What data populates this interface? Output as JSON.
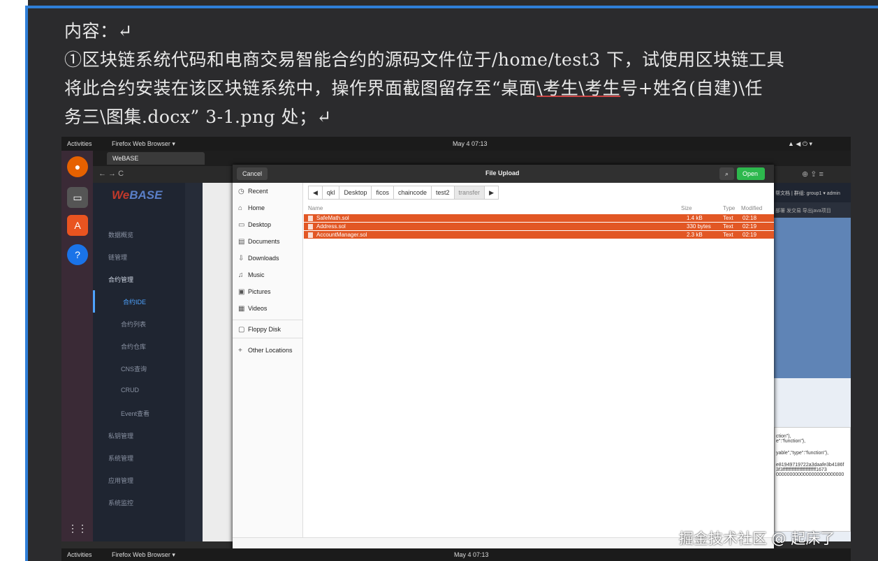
{
  "document": {
    "line1": "内容：↵",
    "line2": "①区块链系统代码和电商交易智能合约的源码文件位于/home/test3 下，试使用区块链工具",
    "line3a": "将此合约安装在该区块链系统中，操作界面截图留存至“桌面",
    "line3b": "\\考生\\考生",
    "line3c": "号+姓名(自建)\\任",
    "line4": "务三\\图集.docx” 3-1.png 处；↵"
  },
  "topbar": {
    "activities": "Activities",
    "app": "Firefox Web Browser ▾",
    "clock": "May 4  07:13",
    "tray": "▲ ◀ ⏻ ▾"
  },
  "browser": {
    "tab_label": "WeBASE",
    "url_nav": "← → C",
    "right_icons": "⊕ ⇪ ≡"
  },
  "webase": {
    "logo_a": "We",
    "logo_b": "BASE",
    "nav": [
      {
        "label": "数据概览"
      },
      {
        "label": "链管理"
      },
      {
        "label": "合约管理"
      },
      {
        "label": "合约IDE"
      },
      {
        "label": "合约列表"
      },
      {
        "label": "合约仓库"
      },
      {
        "label": "CNS查询"
      },
      {
        "label": "CRUD"
      },
      {
        "label": "Event查看"
      },
      {
        "label": "私钥管理"
      },
      {
        "label": "系统管理"
      },
      {
        "label": "应用管理"
      },
      {
        "label": "系统监控"
      }
    ],
    "header_right": "帮文档 | 群组: group1 ▾  admin",
    "toolbar_right": "部署  发交易  导出java项目",
    "code_lines": [
      "ction\"),",
      "e\":\"function\"),",
      "yable\",\"type\":\"function\"),",
      "e81949719722a3daafe3b4186f",
      "3f3ffffffffffffffffffffffffff1673",
      "0000000000000000000000000"
    ]
  },
  "dialog": {
    "title": "File Upload",
    "cancel": "Cancel",
    "open": "Open",
    "sidebar": [
      {
        "icon": "◷",
        "label": "Recent"
      },
      {
        "icon": "⌂",
        "label": "Home"
      },
      {
        "icon": "▭",
        "label": "Desktop"
      },
      {
        "icon": "▤",
        "label": "Documents"
      },
      {
        "icon": "⇩",
        "label": "Downloads"
      },
      {
        "icon": "♫",
        "label": "Music"
      },
      {
        "icon": "▣",
        "label": "Pictures"
      },
      {
        "icon": "▦",
        "label": "Videos"
      },
      {
        "icon": "▢",
        "label": "Floppy Disk"
      },
      {
        "icon": "+",
        "label": "Other Locations"
      }
    ],
    "breadcrumbs": [
      "◀",
      "qkl",
      "Desktop",
      "ficos",
      "chaincode",
      "test2",
      "transfer",
      "▶"
    ],
    "columns": {
      "name": "Name",
      "size": "Size",
      "type": "Type",
      "modified": "Modified"
    },
    "files": [
      {
        "name": "SafeMath.sol",
        "size": "1.4 kB",
        "type": "Text",
        "modified": "02:18"
      },
      {
        "name": "Address.sol",
        "size": "330 bytes",
        "type": "Text",
        "modified": "02:19"
      },
      {
        "name": "AccountManager.sol",
        "size": "2.3 kB",
        "type": "Text",
        "modified": "02:19"
      }
    ]
  },
  "bottombar": {
    "activities": "Activities",
    "app": "Firefox Web Browser ▾",
    "clock": "May 4  07:13"
  },
  "watermark": "掘金技术社区 @ 起床了",
  "colors": {
    "accent_blue": "#2f7fd8",
    "selection": "#e25724",
    "open_button": "#2db84d"
  }
}
